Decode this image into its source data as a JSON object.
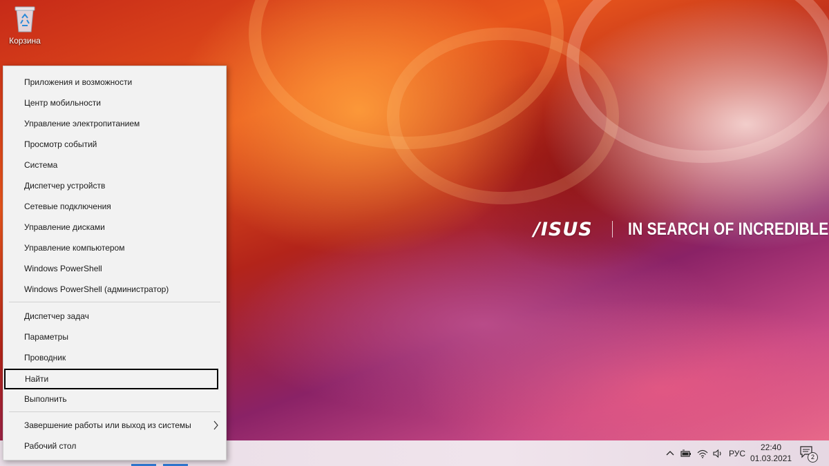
{
  "desktop": {
    "recycle_bin_label": "Корзина",
    "brand_logo": "/ISUS",
    "brand_slogan": "IN SEARCH OF INCREDIBLE"
  },
  "context_menu": {
    "items": [
      {
        "label": "Приложения и возможности"
      },
      {
        "label": "Центр мобильности"
      },
      {
        "label": "Управление электропитанием"
      },
      {
        "label": "Просмотр событий"
      },
      {
        "label": "Система"
      },
      {
        "label": "Диспетчер устройств"
      },
      {
        "label": "Сетевые подключения"
      },
      {
        "label": "Управление дисками"
      },
      {
        "label": "Управление компьютером"
      },
      {
        "label": "Windows PowerShell"
      },
      {
        "label": "Windows PowerShell (администратор)"
      },
      {
        "label": "Диспетчер задач"
      },
      {
        "label": "Параметры"
      },
      {
        "label": "Проводник"
      },
      {
        "label": "Найти"
      },
      {
        "label": "Выполнить"
      },
      {
        "label": "Завершение работы или выход из системы"
      },
      {
        "label": "Рабочий стол"
      }
    ],
    "focused_item": "Найти"
  },
  "taskbar": {
    "language": "РУС",
    "time": "22:40",
    "date": "01.03.2021",
    "notification_count": "2",
    "tray_icons": [
      "chevron-up-icon",
      "battery-icon",
      "wifi-icon",
      "volume-icon",
      "notification-icon"
    ]
  },
  "colors": {
    "menu_background": "#f2f2f2",
    "focus_outline": "#000000",
    "taskbar_accent": "#2f7bd6"
  }
}
